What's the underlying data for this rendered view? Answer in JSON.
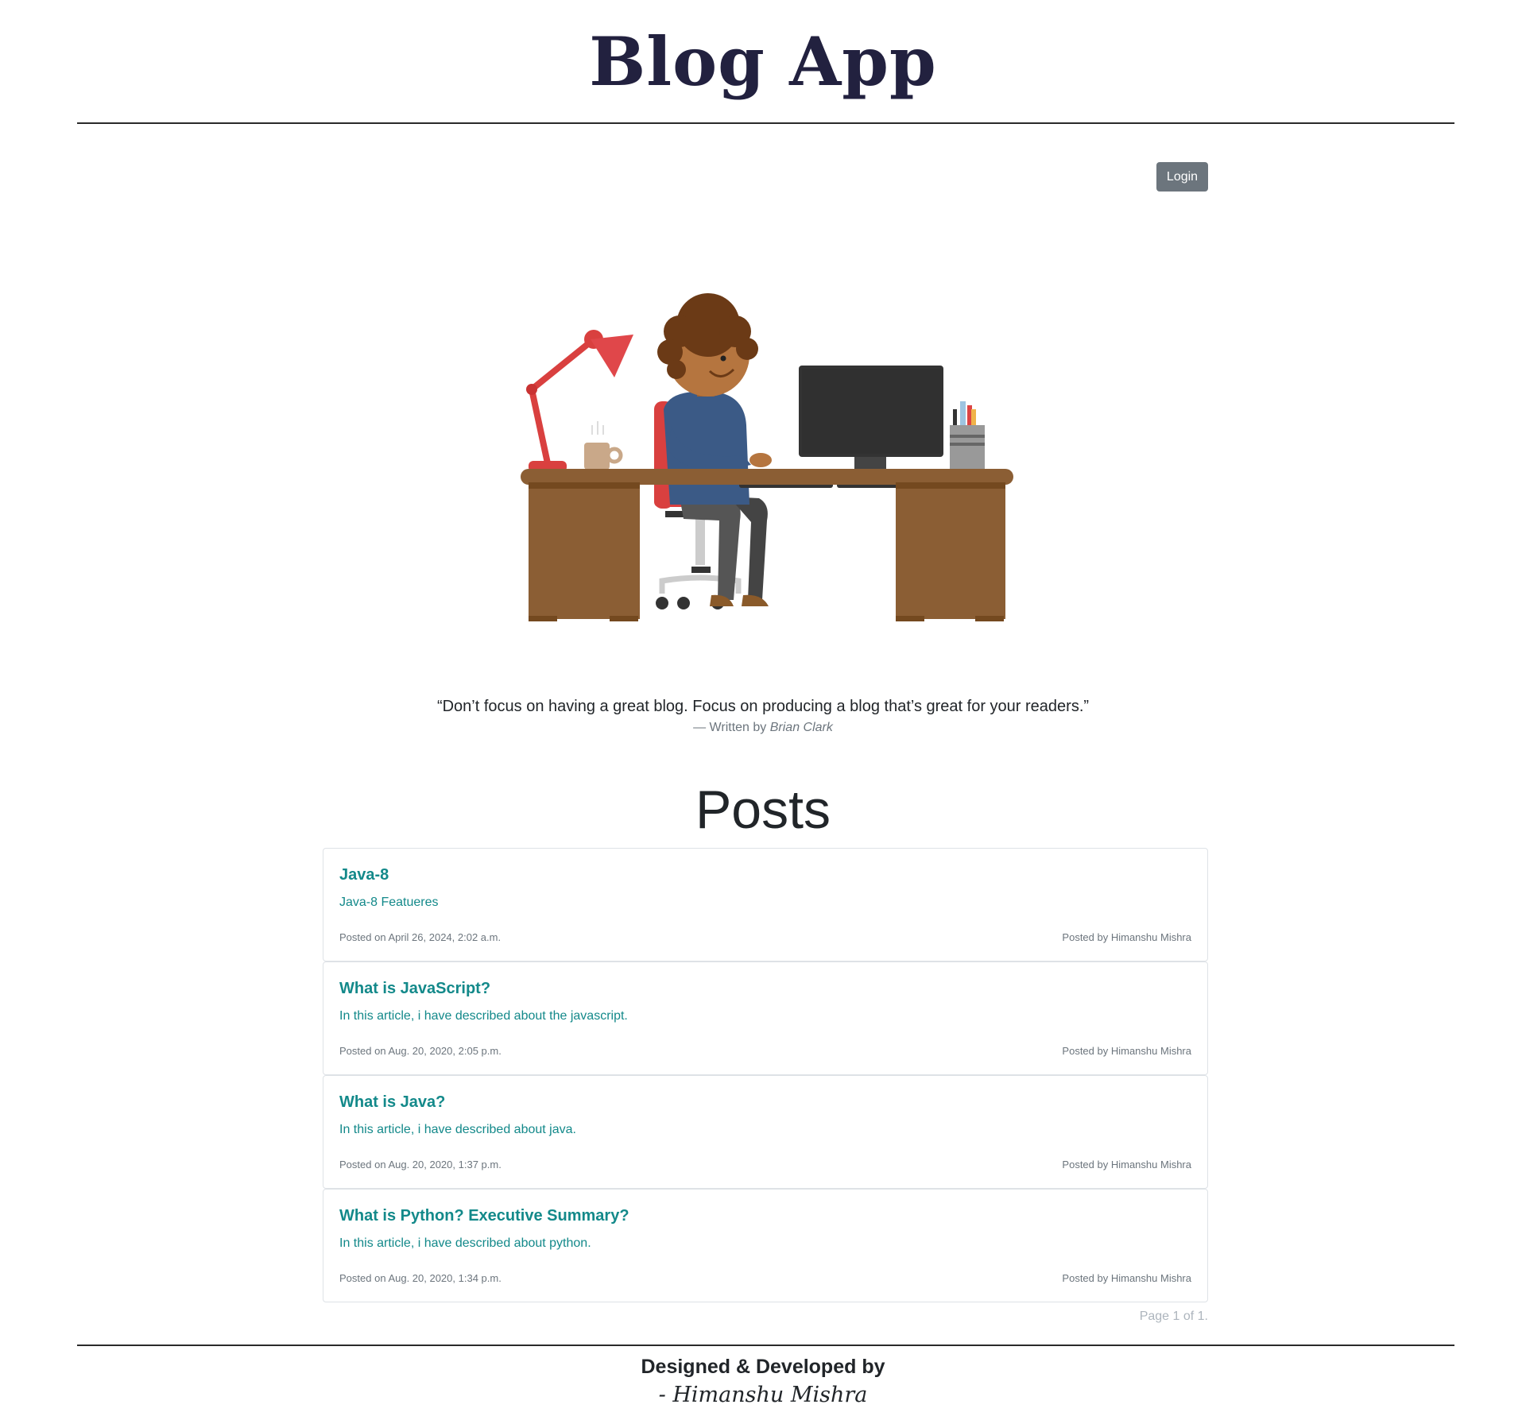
{
  "header": {
    "site_title": "Blog App",
    "login_label": "Login"
  },
  "quote": {
    "text": "“Don’t focus on having a great blog. Focus on producing a blog that’s great for your readers.”",
    "by_prefix": "— Written by ",
    "author": "Brian Clark"
  },
  "posts": {
    "heading": "Posts",
    "items": [
      {
        "title": "Java-8",
        "summary": "Java-8 Featueres",
        "date": "Posted on April 26, 2024, 2:02 a.m.",
        "author": "Posted by Himanshu Mishra"
      },
      {
        "title": "What is JavaScript?",
        "summary": "In this article, i have described about the javascript.",
        "date": "Posted on Aug. 20, 2020, 2:05 p.m.",
        "author": "Posted by Himanshu Mishra"
      },
      {
        "title": "What is Java?",
        "summary": "In this article, i have described about java.",
        "date": "Posted on Aug. 20, 2020, 1:37 p.m.",
        "author": "Posted by Himanshu Mishra"
      },
      {
        "title": "What is Python? Executive Summary?",
        "summary": "In this article, i have described about python.",
        "date": "Posted on Aug. 20, 2020, 1:34 p.m.",
        "author": "Posted by Himanshu Mishra"
      }
    ],
    "pagination": "Page 1 of 1."
  },
  "footer": {
    "line1": "Designed & Developed by",
    "line2": "- Himanshu Mishra"
  },
  "colors": {
    "title": "#22213f",
    "link": "#13898a",
    "button": "#6c757d",
    "muted": "#6c757d"
  },
  "hero_image": "person-at-desk-illustration"
}
